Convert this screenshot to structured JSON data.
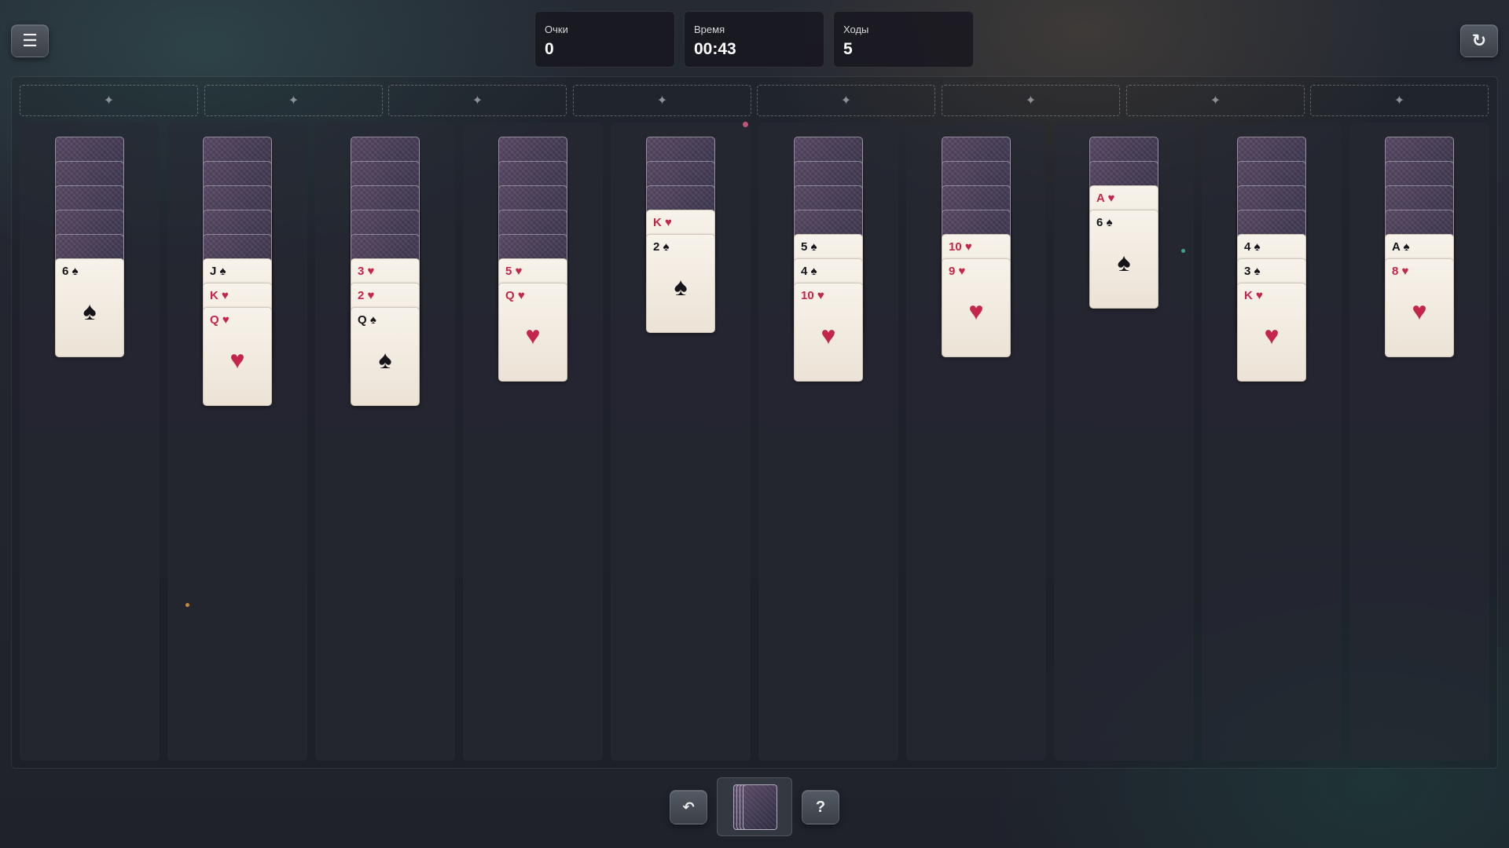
{
  "header": {
    "menu_icon": "menu-icon",
    "restart_icon": "restart-icon",
    "stats": [
      {
        "label": "Очки",
        "value": "0"
      },
      {
        "label": "Время",
        "value": "00:43"
      },
      {
        "label": "Ходы",
        "value": "5"
      }
    ]
  },
  "foundations": {
    "count": 8,
    "placeholder_glyph": "✦"
  },
  "tableau": [
    {
      "face_down": 5,
      "face_up": [
        {
          "rank": "6",
          "suit": "♠",
          "color": "black"
        }
      ]
    },
    {
      "face_down": 5,
      "face_up": [
        {
          "rank": "J",
          "suit": "♠",
          "color": "black"
        },
        {
          "rank": "K",
          "suit": "♥",
          "color": "red"
        },
        {
          "rank": "Q",
          "suit": "♥",
          "color": "red"
        }
      ]
    },
    {
      "face_down": 5,
      "face_up": [
        {
          "rank": "3",
          "suit": "♥",
          "color": "red"
        },
        {
          "rank": "2",
          "suit": "♥",
          "color": "red"
        },
        {
          "rank": "Q",
          "suit": "♠",
          "color": "black"
        }
      ]
    },
    {
      "face_down": 5,
      "face_up": [
        {
          "rank": "5",
          "suit": "♥",
          "color": "red"
        },
        {
          "rank": "Q",
          "suit": "♥",
          "color": "red"
        }
      ]
    },
    {
      "face_down": 3,
      "face_up": [
        {
          "rank": "K",
          "suit": "♥",
          "color": "red"
        },
        {
          "rank": "2",
          "suit": "♠",
          "color": "black"
        }
      ]
    },
    {
      "face_down": 4,
      "face_up": [
        {
          "rank": "5",
          "suit": "♠",
          "color": "black"
        },
        {
          "rank": "4",
          "suit": "♠",
          "color": "black"
        },
        {
          "rank": "10",
          "suit": "♥",
          "color": "red"
        }
      ]
    },
    {
      "face_down": 4,
      "face_up": [
        {
          "rank": "10",
          "suit": "♥",
          "color": "red"
        },
        {
          "rank": "9",
          "suit": "♥",
          "color": "red"
        }
      ]
    },
    {
      "face_down": 2,
      "face_up": [
        {
          "rank": "A",
          "suit": "♥",
          "color": "red"
        },
        {
          "rank": "6",
          "suit": "♠",
          "color": "black"
        }
      ]
    },
    {
      "face_down": 4,
      "face_up": [
        {
          "rank": "4",
          "suit": "♠",
          "color": "black"
        },
        {
          "rank": "3",
          "suit": "♠",
          "color": "black"
        },
        {
          "rank": "K",
          "suit": "♥",
          "color": "red"
        }
      ]
    },
    {
      "face_down": 4,
      "face_up": [
        {
          "rank": "A",
          "suit": "♠",
          "color": "black"
        },
        {
          "rank": "8",
          "suit": "♥",
          "color": "red"
        }
      ]
    }
  ],
  "footer": {
    "undo_icon": "undo-icon",
    "stock_icon": "stock-pile",
    "help_label": "?"
  },
  "colors": {
    "red_suit": "#c3264a",
    "black_suit": "#15151a",
    "card_face": "#f3ede4"
  }
}
